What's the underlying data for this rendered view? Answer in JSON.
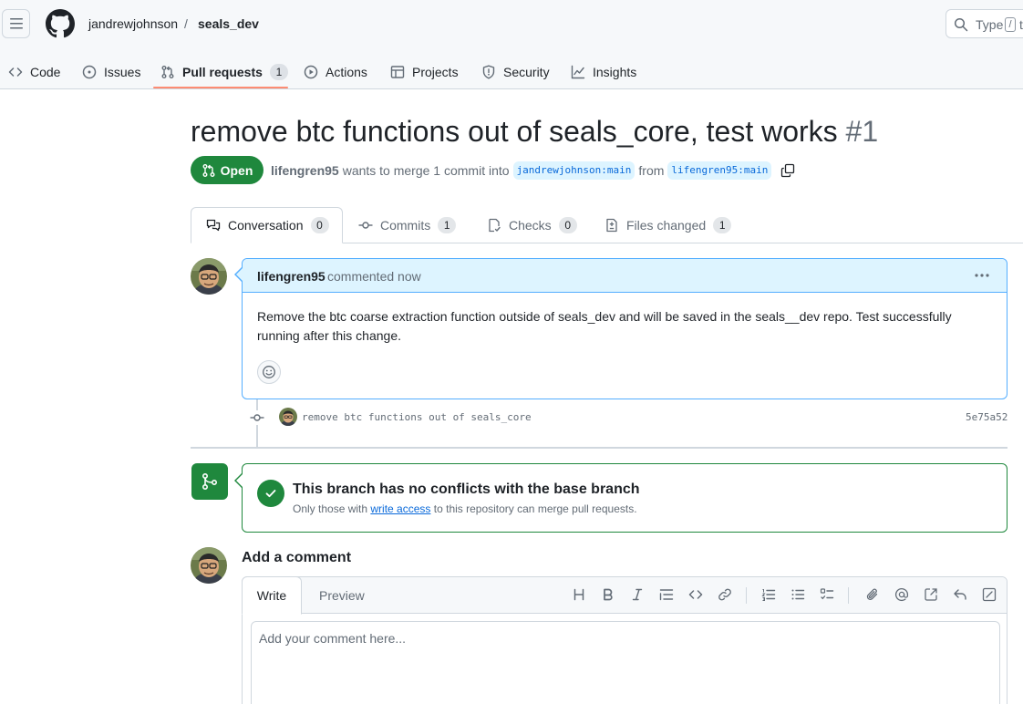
{
  "header": {
    "owner": "jandrewjohnson",
    "separator": "/",
    "repo": "seals_dev",
    "search_prefix": "Type",
    "search_kbd": "/",
    "search_suffix": "t"
  },
  "repo_nav": {
    "items": [
      {
        "label": "Code",
        "icon": "code-icon"
      },
      {
        "label": "Issues",
        "icon": "issue-opened-icon"
      },
      {
        "label": "Pull requests",
        "icon": "git-pull-request-icon",
        "count": "1",
        "active": true
      },
      {
        "label": "Actions",
        "icon": "play-icon"
      },
      {
        "label": "Projects",
        "icon": "table-icon"
      },
      {
        "label": "Security",
        "icon": "shield-icon"
      },
      {
        "label": "Insights",
        "icon": "graph-icon"
      }
    ]
  },
  "pr": {
    "title": "remove btc functions out of seals_core, test works",
    "number": "#1",
    "state": "Open",
    "author": "lifengren95",
    "merge_text_1": "wants to merge 1 commit into",
    "base_branch": "jandrewjohnson:main",
    "from_text": "from",
    "head_branch": "lifengren95:main"
  },
  "tabs": [
    {
      "label": "Conversation",
      "count": "0",
      "icon": "comment-discussion-icon"
    },
    {
      "label": "Commits",
      "count": "1",
      "icon": "git-commit-icon"
    },
    {
      "label": "Checks",
      "count": "0",
      "icon": "checklist-icon"
    },
    {
      "label": "Files changed",
      "count": "1",
      "icon": "file-diff-icon"
    }
  ],
  "comment": {
    "author": "lifengren95",
    "time": "commented now",
    "body": "Remove the btc coarse extraction function outside of seals_dev and will be saved in the seals__dev repo. Test successfully running after this change."
  },
  "commit": {
    "message": "remove btc functions out of seals_core",
    "sha": "5e75a52"
  },
  "merge": {
    "title": "This branch has no conflicts with the base branch",
    "sub_before": "Only those with",
    "sub_link": "write access",
    "sub_after": "to this repository can merge pull requests."
  },
  "add_comment": {
    "title": "Add a comment",
    "tab_write": "Write",
    "tab_preview": "Preview",
    "placeholder": "Add your comment here..."
  },
  "colors": {
    "accent_green": "#1f883d",
    "comment_blue": "#ddf4ff",
    "link_blue": "#0969da",
    "nav_underline": "#fd8c73"
  }
}
